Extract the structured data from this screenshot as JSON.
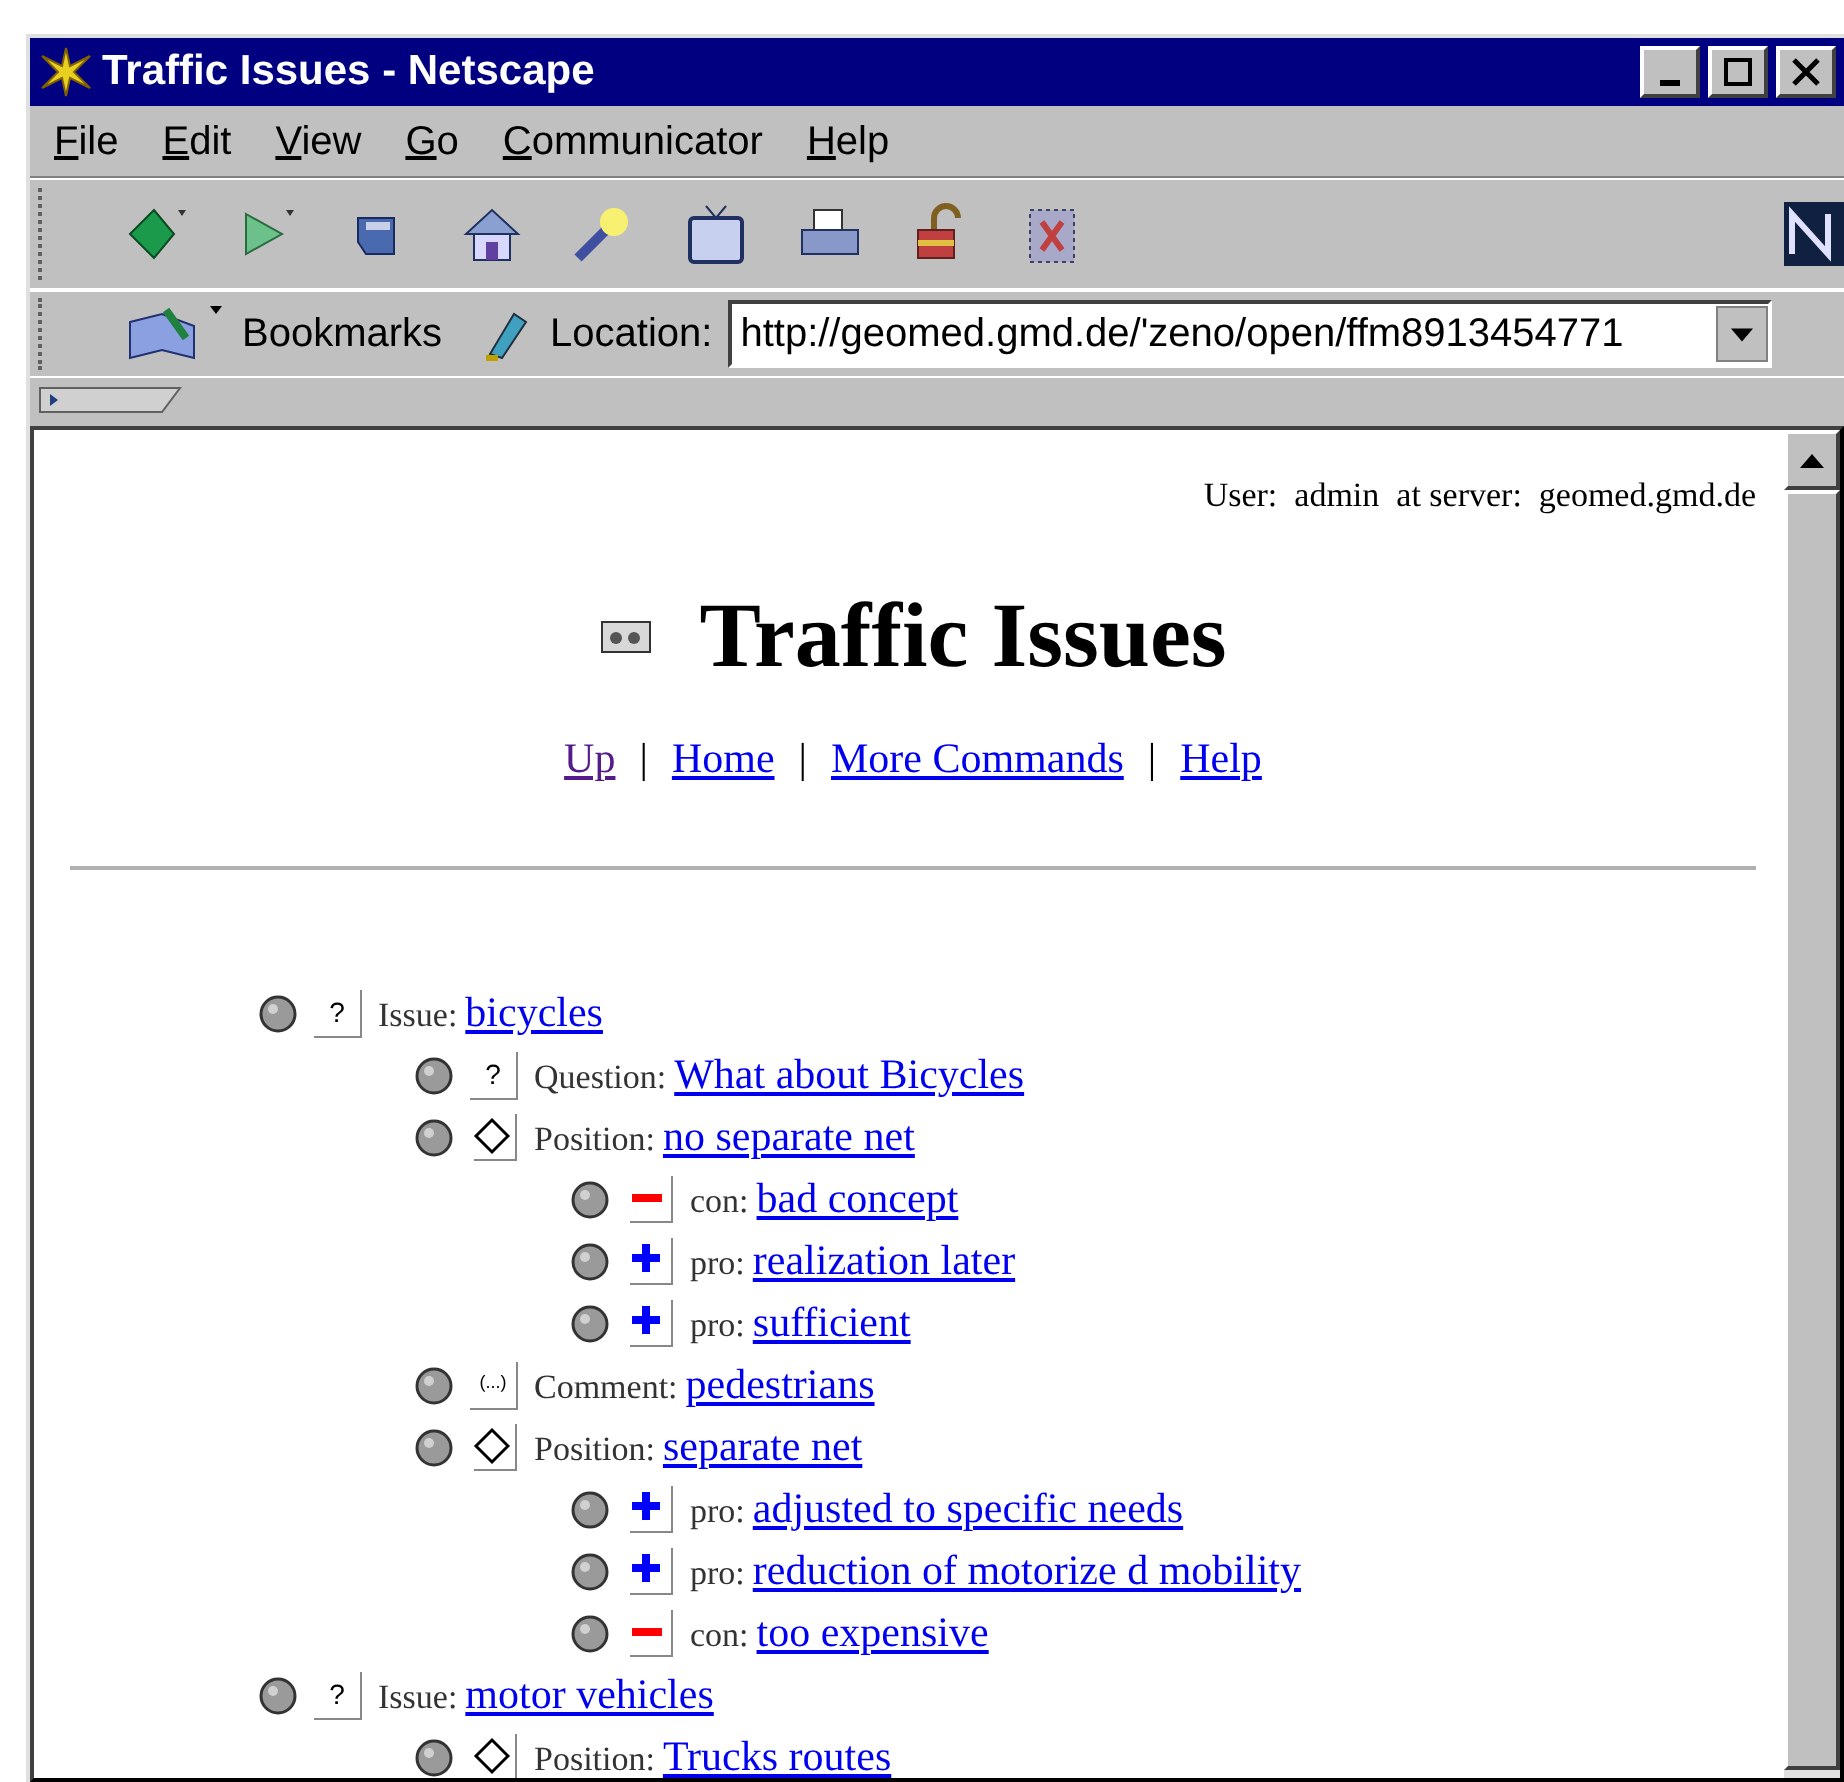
{
  "window": {
    "title": "Traffic Issues - Netscape"
  },
  "menu": [
    "File",
    "Edit",
    "View",
    "Go",
    "Communicator",
    "Help"
  ],
  "location_bar": {
    "bookmarks": "Bookmarks",
    "label": "Location:",
    "value": "http://geomed.gmd.de/'zeno/open/ffm8913454771"
  },
  "page": {
    "user_line": "User:  admin  at server:  geomed.gmd.de",
    "title": "Traffic Issues",
    "nav_links": [
      {
        "text": "Up",
        "visited": true
      },
      {
        "text": "Home",
        "visited": false
      },
      {
        "text": "More Commands",
        "visited": false
      },
      {
        "text": "Help",
        "visited": false
      }
    ],
    "separator": "|",
    "tree": [
      {
        "kind": "issue",
        "symbol": "?",
        "label": "Issue:",
        "link": "bicycles",
        "children": [
          {
            "kind": "question",
            "symbol": "?",
            "label": "Question:",
            "link": "What about Bicycles"
          },
          {
            "kind": "position",
            "label": "Position:",
            "link": "no separate net",
            "children": [
              {
                "kind": "con",
                "label": "con:",
                "link": "bad concept"
              },
              {
                "kind": "pro",
                "label": "pro:",
                "link": "realization later"
              },
              {
                "kind": "pro",
                "label": "pro:",
                "link": "sufficient"
              }
            ]
          },
          {
            "kind": "comment",
            "symbol": "(...)",
            "label": "Comment:",
            "link": "pedestrians"
          },
          {
            "kind": "position",
            "label": "Position:",
            "link": "separate net",
            "children": [
              {
                "kind": "pro",
                "label": "pro:",
                "link": "adjusted to specific needs"
              },
              {
                "kind": "pro",
                "label": "pro:",
                "link": "reduction of motorize d mobility"
              },
              {
                "kind": "con",
                "label": "con:",
                "link": "too expensive"
              }
            ]
          }
        ]
      },
      {
        "kind": "issue",
        "symbol": "?",
        "label": "Issue:",
        "link": "motor vehicles",
        "children": [
          {
            "kind": "position",
            "label": "Position:",
            "link": "Trucks routes"
          }
        ]
      }
    ]
  }
}
